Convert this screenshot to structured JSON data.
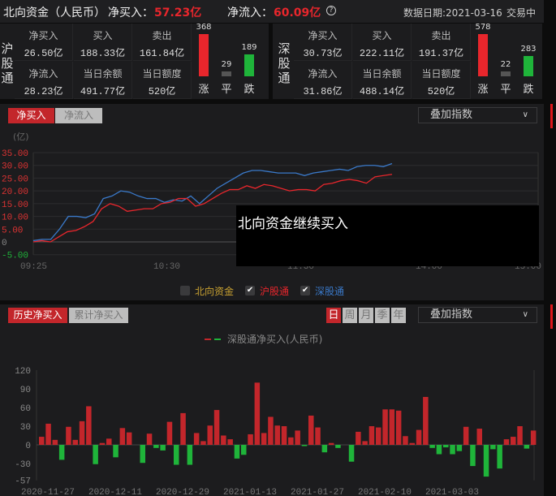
{
  "header": {
    "title": "北向资金（人民币）",
    "net_buy_label": "净买入：",
    "net_buy": "57.23亿",
    "net_flow_label": "净流入：",
    "net_flow": "60.09亿",
    "help_icon": "?",
    "date_label": "数据日期:2021-03-16",
    "status": "交易中"
  },
  "sh": {
    "name": "沪股通",
    "net_buy_label": "净买入",
    "net_buy": "26.50亿",
    "buy_label": "买入",
    "buy": "188.33亿",
    "sell_label": "卖出",
    "sell": "161.84亿",
    "net_flow_label": "净流入",
    "net_flow": "28.23亿",
    "balance_label": "当日余额",
    "balance": "491.77亿",
    "quota_label": "当日额度",
    "quota": "520亿",
    "up": 368,
    "flat": 29,
    "down": 189,
    "up_label": "涨",
    "flat_label": "平",
    "down_label": "跌"
  },
  "sz": {
    "name": "深股通",
    "net_buy_label": "净买入",
    "net_buy": "30.73亿",
    "buy_label": "买入",
    "buy": "222.11亿",
    "sell_label": "卖出",
    "sell": "191.37亿",
    "net_flow_label": "净流入",
    "net_flow": "31.86亿",
    "balance_label": "当日余额",
    "balance": "488.14亿",
    "quota_label": "当日额度",
    "quota": "520亿",
    "up": 578,
    "flat": 22,
    "down": 283,
    "up_label": "涨",
    "flat_label": "平",
    "down_label": "跌"
  },
  "intraday": {
    "tab_active": "净买入",
    "tab_other": "净流入",
    "overlay_select": "叠加指数",
    "chevron": "∨",
    "unit": "(亿)",
    "overlay_text": "北向资金继续买入",
    "legend": [
      {
        "label": "北向资金",
        "checked": false
      },
      {
        "label": "沪股通",
        "checked": true
      },
      {
        "label": "深股通",
        "checked": true
      }
    ]
  },
  "history": {
    "tab_active": "历史净买入",
    "tab_other": "累计净买入",
    "periods": [
      "日",
      "周",
      "月",
      "季",
      "年"
    ],
    "overlay_select": "叠加指数",
    "chevron": "∨",
    "legend": "深股通净买入(人民币)"
  },
  "chart_data": [
    {
      "type": "line",
      "title": "",
      "ylabel": "(亿)",
      "ylim": [
        -5,
        35
      ],
      "yticks": [
        "35.00",
        "30.00",
        "25.00",
        "20.00",
        "15.00",
        "10.00",
        "5.00",
        "0",
        "-5.00"
      ],
      "xticks": [
        "09:25",
        "10:30",
        "11:30",
        "14:00",
        "15:00"
      ],
      "series": [
        {
          "name": "深股通",
          "color": "#3a79c9",
          "values": [
            0.5,
            1,
            1,
            5,
            10,
            10,
            9.5,
            11,
            17,
            18,
            20,
            19.5,
            18,
            17,
            17,
            15.5,
            16.5,
            16,
            18,
            15,
            18,
            21,
            23,
            25,
            27,
            28,
            28,
            27.5,
            27,
            27,
            27,
            26,
            27,
            27.5,
            28,
            28.5,
            28,
            29.5,
            30,
            30,
            29.5,
            30.7
          ]
        },
        {
          "name": "沪股通",
          "color": "#e8262c",
          "values": [
            0,
            0.5,
            0,
            2,
            4,
            4.5,
            6,
            8,
            13,
            15,
            14,
            12,
            12.5,
            13,
            13,
            15,
            15.5,
            17,
            17,
            14,
            15,
            17,
            19,
            20.5,
            20.5,
            22,
            21,
            22.5,
            22,
            21,
            20,
            20.5,
            20.5,
            20,
            22.5,
            23,
            24,
            24.5,
            24,
            23,
            25.5,
            26,
            26.5
          ]
        }
      ]
    },
    {
      "type": "bar",
      "title": "深股通净买入(人民币)",
      "ylim": [
        -57,
        120
      ],
      "yticks": [
        "120",
        "90",
        "60",
        "30",
        "0",
        "-30",
        "-57"
      ],
      "xticks": [
        {
          "index": 1,
          "label": "2020-11-27"
        },
        {
          "index": 11,
          "label": "2020-12-11"
        },
        {
          "index": 21,
          "label": "2020-12-29"
        },
        {
          "index": 31,
          "label": "2021-01-13"
        },
        {
          "index": 41,
          "label": "2021-01-27"
        },
        {
          "index": 51,
          "label": "2021-02-10"
        },
        {
          "index": 61,
          "label": "2021-03-03"
        }
      ],
      "values": [
        13,
        34,
        8,
        -24,
        29,
        8,
        38,
        62,
        -31,
        3,
        10,
        -20,
        27,
        20,
        0,
        -29,
        18,
        -5,
        -9,
        37,
        -32,
        51,
        -32,
        19,
        6,
        31,
        56,
        15,
        9,
        -22,
        -16,
        17,
        100,
        19,
        45,
        31,
        30,
        12,
        23,
        -2,
        47,
        28,
        -12,
        3,
        -5,
        0,
        -27,
        21,
        6,
        30,
        28,
        57,
        57,
        55,
        14,
        3,
        24,
        77,
        -5,
        -15,
        -4,
        -15,
        -10,
        29,
        -34,
        26,
        -51,
        -7,
        -38,
        9,
        13,
        30,
        -6,
        23
      ],
      "colors": {
        "positive": "#c3262b",
        "negative": "#1fb43a"
      }
    }
  ]
}
